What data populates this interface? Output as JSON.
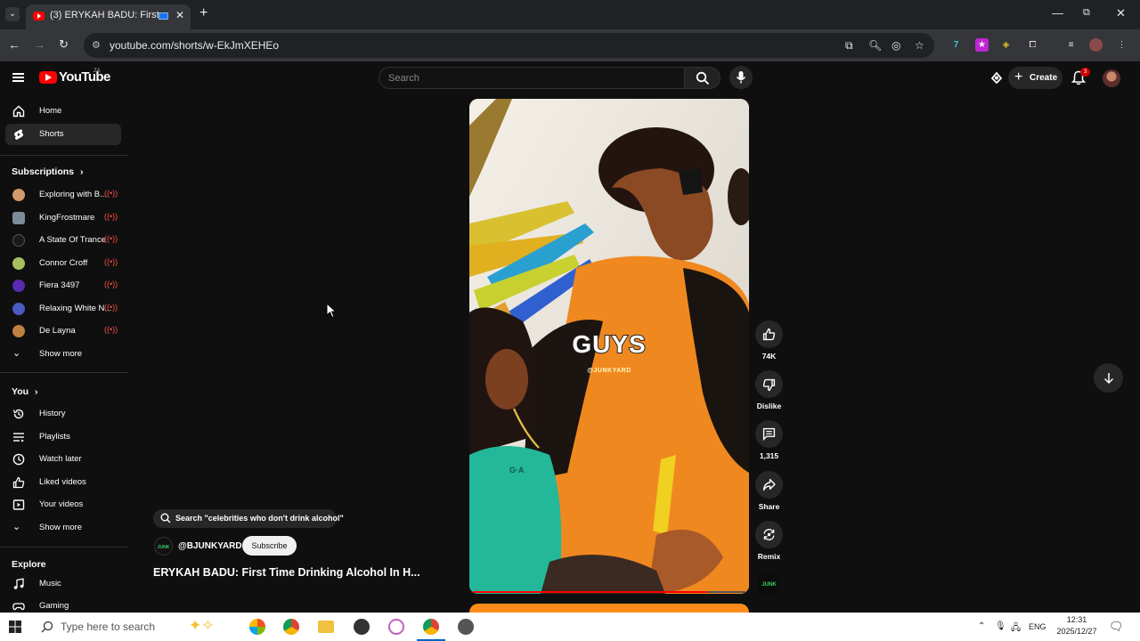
{
  "browser": {
    "tab_title": "(3) ERYKAH BADU: First Tim",
    "url": "youtube.com/shorts/w-EkJmXEHEo",
    "window_controls": {
      "minimize": "—",
      "maximize": "⧉",
      "close": "✕"
    }
  },
  "youtube": {
    "wordmark": "YouTube",
    "country_code": "ZA",
    "search_placeholder": "Search",
    "create_label": "Create",
    "notification_count": "3"
  },
  "sidebar": {
    "main": [
      {
        "label": "Home",
        "icon": "home-icon"
      },
      {
        "label": "Shorts",
        "icon": "shorts-icon",
        "active": true
      }
    ],
    "subscriptions_heading": "Subscriptions",
    "subscriptions": [
      {
        "label": "Exploring with B...",
        "live": true,
        "color": "#d09a6a"
      },
      {
        "label": "KingFrostmare",
        "live": true,
        "color": "#7b8b9a"
      },
      {
        "label": "A State Of Trance",
        "live": true,
        "color": "#1a1a1a"
      },
      {
        "label": "Connor Croff",
        "live": true,
        "color": "#a8c060"
      },
      {
        "label": "Fiera 3497",
        "live": true,
        "color": "#5a2ab0"
      },
      {
        "label": "Relaxing White N...",
        "live": true,
        "color": "#4a5ac0"
      },
      {
        "label": "De Layna",
        "live": true,
        "color": "#c08040"
      }
    ],
    "show_more_1": "Show more",
    "you_heading": "You",
    "you_items": [
      {
        "label": "History",
        "icon": "history-icon"
      },
      {
        "label": "Playlists",
        "icon": "playlists-icon"
      },
      {
        "label": "Watch later",
        "icon": "watch-later-icon"
      },
      {
        "label": "Liked videos",
        "icon": "liked-videos-icon"
      },
      {
        "label": "Your videos",
        "icon": "your-videos-icon"
      }
    ],
    "show_more_2": "Show more",
    "explore_heading": "Explore",
    "explore_items": [
      {
        "label": "Music",
        "icon": "music-icon"
      },
      {
        "label": "Gaming",
        "icon": "gaming-icon"
      }
    ]
  },
  "short": {
    "search_chip": "Search \"celebrities who don't drink alcohol\"",
    "channel": "@BJUNKYARD",
    "subscribe_label": "Subscribe",
    "title": "ERYKAH BADU: First Time Drinking Alcohol In H...",
    "caption": "GUYS",
    "watermark": "@JUNKYARD",
    "progress": 0.86,
    "actions": {
      "likes": "74K",
      "dislike": "Dislike",
      "comments": "1,315",
      "share": "Share",
      "remix": "Remix"
    }
  },
  "taskbar": {
    "search_placeholder": "Type here to search",
    "language": "ENG",
    "time": "12:31",
    "date": "2025/12/27"
  }
}
